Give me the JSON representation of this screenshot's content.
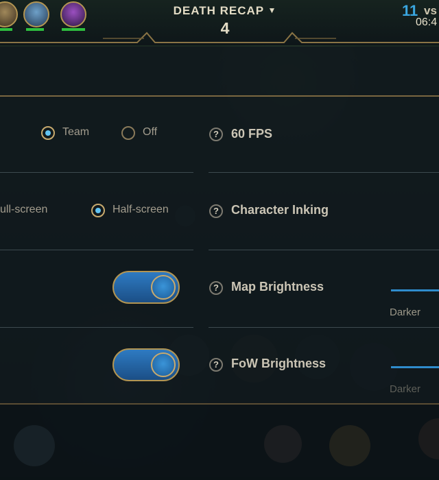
{
  "hud": {
    "title": "DEATH RECAP",
    "title_icon": "chevron-down-icon",
    "count": "4",
    "score": "11",
    "vs": "vs",
    "timer": "06:4",
    "champions": [
      {
        "name": "champion-portrait-1",
        "colors": [
          "#a0885a",
          "#3a2d1e"
        ],
        "health": 0.8
      },
      {
        "name": "champion-portrait-2",
        "colors": [
          "#6ea0c8",
          "#243a55"
        ],
        "health": 0.7
      },
      {
        "name": "champion-portrait-3",
        "colors": [
          "#9b4fc0",
          "#2a1740"
        ],
        "health": 0.95
      }
    ]
  },
  "settings": {
    "row1": {
      "options": [
        {
          "label": "Team",
          "selected": true
        },
        {
          "label": "Off",
          "selected": false
        }
      ],
      "right_label": "60 FPS"
    },
    "row2": {
      "options": [
        {
          "label": "ull-screen",
          "selected": false
        },
        {
          "label": "Half-screen",
          "selected": true
        }
      ],
      "right_label": "Character Inking"
    },
    "row3": {
      "toggle_on": true,
      "right_label": "Map Brightness",
      "slider_caption": "Darker"
    },
    "row4": {
      "toggle_on": true,
      "right_label": "FoW Brightness",
      "slider_caption": "Darker"
    },
    "help_glyph": "?"
  },
  "colors": {
    "accent_blue": "#2f8ccc",
    "gold": "#c8aa6e",
    "score_blue": "#3aa6e0"
  }
}
